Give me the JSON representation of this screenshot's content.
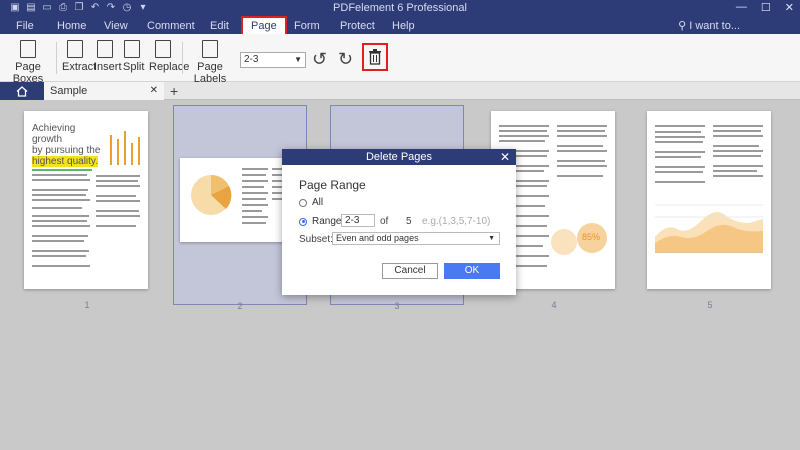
{
  "app": {
    "title": "PDFelement 6 Professional",
    "i_want_to": "I want to..."
  },
  "menu": [
    "File",
    "Home",
    "View",
    "Comment",
    "Edit",
    "Page",
    "Form",
    "Protect",
    "Help"
  ],
  "active_menu": "Page",
  "ribbon": {
    "page_boxes": "Page Boxes",
    "extract": "Extract",
    "insert": "Insert",
    "split": "Split",
    "replace": "Replace",
    "page_labels": "Page Labels",
    "page_range_value": "2-3"
  },
  "tabs": {
    "document": "Sample Documen...nded"
  },
  "thumbnails": [
    {
      "number": "1",
      "selected": false
    },
    {
      "number": "2",
      "selected": true
    },
    {
      "number": "3",
      "selected": true
    },
    {
      "number": "4",
      "selected": false
    },
    {
      "number": "5",
      "selected": false
    }
  ],
  "page1": {
    "heading_line1": "Achieving growth",
    "heading_line2": "by pursuing the",
    "heading_line3": "highest quality."
  },
  "page4": {
    "percent": "85%"
  },
  "dialog": {
    "title": "Delete Pages",
    "section": "Page Range",
    "all_label": "All",
    "range_label": "Range:",
    "range_value": "2-3",
    "of_label": "of",
    "total_pages": "5",
    "range_hint": "e.g.(1,3,5,7-10)",
    "subset_label": "Subset:",
    "subset_value": "Even and odd pages",
    "cancel": "Cancel",
    "ok": "OK",
    "selected_option": "range"
  },
  "colors": {
    "titlebar": "#2d3b77",
    "ok_button": "#4a79f5",
    "highlight_red": "#e02020",
    "selection": "#c3c6d9"
  }
}
